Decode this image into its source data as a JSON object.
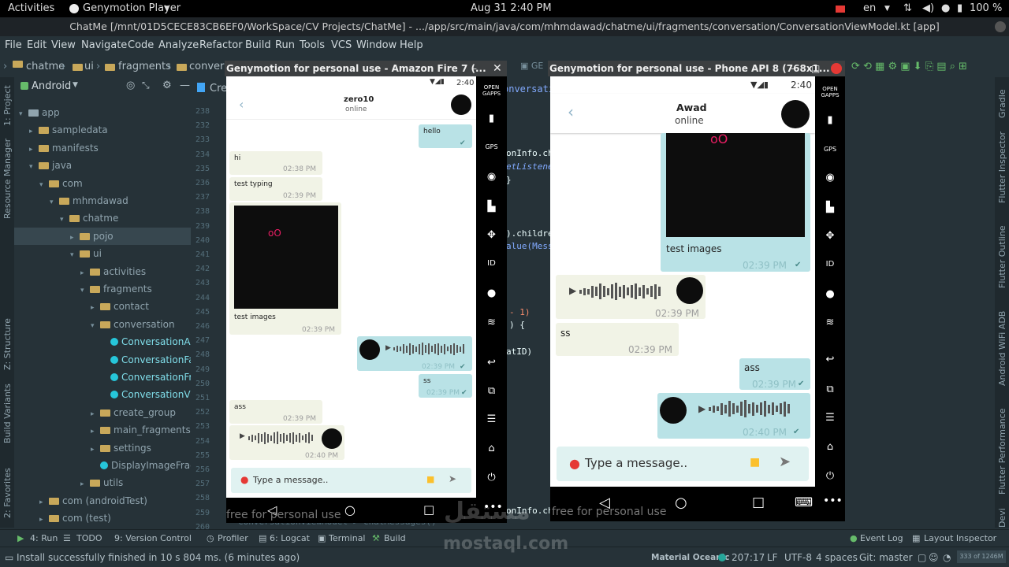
{
  "topbar": {
    "activities": "Activities",
    "app": "Genymotion Player",
    "clock": "Aug 31  2:40 PM",
    "lang": "en",
    "battery": "100 %"
  },
  "titlebar": "ChatMe [/mnt/01D5CECE83CB6EF0/WorkSpace/CV Projects/ChatMe] - .../app/src/main/java/com/mhmdawad/chatme/ui/fragments/conversation/ConversationViewModel.kt [app]",
  "menu": [
    "File",
    "Edit",
    "View",
    "Navigate",
    "Code",
    "Analyze",
    "Refactor",
    "Build",
    "Run",
    "Tools",
    "VCS",
    "Window",
    "Help"
  ],
  "breadcrumb": [
    "chatme",
    "ui",
    "fragments",
    "convers"
  ],
  "project": {
    "selector": "Android",
    "tab_label": "Cre",
    "tree": [
      {
        "label": "app",
        "d": 0
      },
      {
        "label": "sampledata",
        "d": 1
      },
      {
        "label": "manifests",
        "d": 1
      },
      {
        "label": "java",
        "d": 1
      },
      {
        "label": "com",
        "d": 2
      },
      {
        "label": "mhmdawad",
        "d": 3
      },
      {
        "label": "chatme",
        "d": 4
      },
      {
        "label": "pojo",
        "d": 5
      },
      {
        "label": "ui",
        "d": 5
      },
      {
        "label": "activities",
        "d": 6
      },
      {
        "label": "fragments",
        "d": 6
      },
      {
        "label": "contact",
        "d": 7
      },
      {
        "label": "conversation",
        "d": 7
      },
      {
        "label": "ConversationAc",
        "d": 8
      },
      {
        "label": "ConversationFa",
        "d": 8
      },
      {
        "label": "ConversationFr",
        "d": 8
      },
      {
        "label": "ConversationVi",
        "d": 8
      },
      {
        "label": "create_group",
        "d": 7
      },
      {
        "label": "main_fragments",
        "d": 7
      },
      {
        "label": "settings",
        "d": 7
      },
      {
        "label": "DisplayImageFrag",
        "d": 7
      },
      {
        "label": "utils",
        "d": 6
      },
      {
        "label": "com (androidTest)",
        "d": 2
      },
      {
        "label": "com (test)",
        "d": 2
      }
    ]
  },
  "line_numbers": [
    "238",
    "232",
    "233",
    "234",
    "235",
    "236",
    "237",
    "238",
    "239",
    "240",
    "241",
    "242",
    "243",
    "244",
    "245",
    "246",
    "247",
    "248",
    "249",
    "250",
    "251",
    "252",
    "253",
    "254",
    "255",
    "256",
    "257",
    "258",
    "259",
    "260"
  ],
  "code_fragments": [
    "onInfo.cha",
    "etListener",
    "}",
    ").childre",
    "alue(Messa",
    "- 1)",
    ") {",
    "atID)",
    "onInfo.cha"
  ],
  "left_strip": [
    "1: Project",
    "Resource Manager",
    "Z: Structure",
    "Build Variants",
    "2: Favorites"
  ],
  "right_strip": [
    "Gradle",
    "Flutter Inspector",
    "Flutter Outline",
    "Android WiFi ADB",
    "Flutter Performance",
    "Devi"
  ],
  "emu1": {
    "window_title": "Genymotion for personal use - Amazon Fire 7 (...",
    "time": "2:40",
    "contact": "zero10",
    "status": "online",
    "messages": {
      "hello": "hello",
      "hi": "hi",
      "hi_time": "02:38 PM",
      "typing": "test typing",
      "typing_time": "02:39 PM",
      "img_caption": "test images",
      "img_time": "02:39 PM",
      "voice_time": "02:39 PM",
      "ss": "ss",
      "ss_time": "02:39 PM",
      "ass": "ass",
      "ass_time": "02:39 PM",
      "voice2_time": "02:40 PM"
    },
    "input_placeholder": "Type a message..",
    "watermark": "free for personal use"
  },
  "emu2": {
    "window_title": "Genymotion for personal use - Phone API 8 (768x1...",
    "time": "2:40",
    "contact": "Awad",
    "status": "online",
    "messages": {
      "img_caption": "test images",
      "img_time": "02:39 PM",
      "voice_time": "02:39 PM",
      "ss": "ss",
      "ss_time": "02:39 PM",
      "ass": "ass",
      "ass_time": "02:39 PM",
      "voice2_time": "02:40 PM"
    },
    "input_placeholder": "Type a message..",
    "watermark": "free for personal use"
  },
  "bottom_tools": [
    "4: Run",
    "TODO",
    "9: Version Control",
    "Profiler",
    "6: Logcat",
    "Terminal",
    "Build",
    "Event Log",
    "Layout Inspector"
  ],
  "editor_tab": "ConversationViewModel > chatMessages()",
  "status": {
    "message": "Install successfully finished in 10 s 804 ms. (6 minutes ago)",
    "theme": "Material Oceanic",
    "position": "207:17",
    "lf": "LF",
    "encoding": "UTF-8",
    "indent": "4 spaces",
    "git": "Git: master",
    "memory": "333 of 1246M"
  },
  "logo": {
    "arabic": "مستقل",
    "latin": "mostaql.com"
  }
}
